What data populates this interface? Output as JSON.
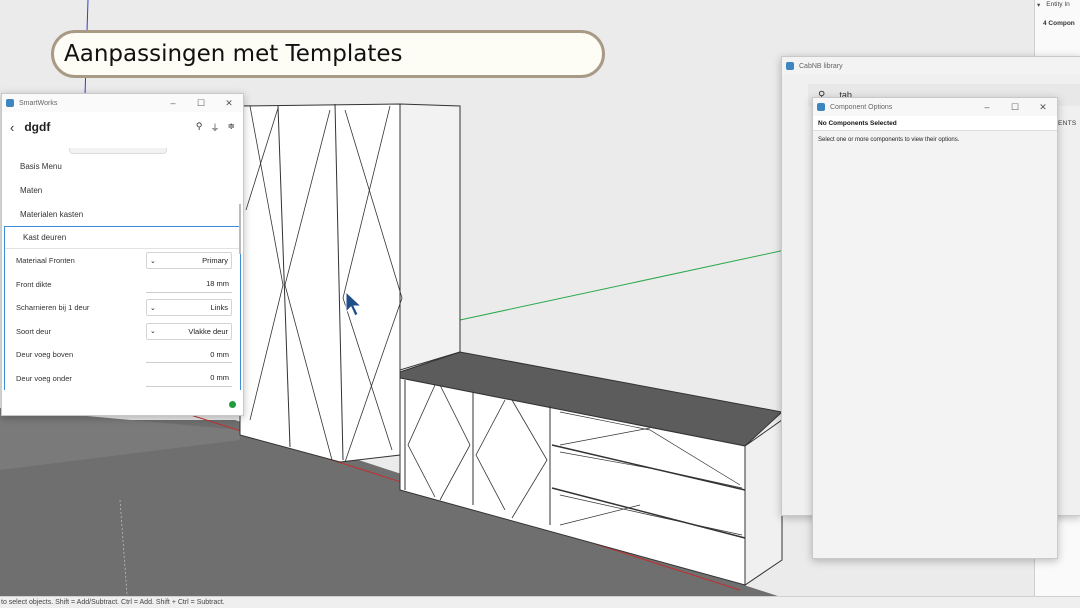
{
  "banner": {
    "title": "Aanpassingen met Templates"
  },
  "smartworks": {
    "window_title": "SmartWorks",
    "header_title": "dgdf",
    "menu_items": [
      "Basis Menu",
      "Maten",
      "Materialen kasten"
    ],
    "section_title": "Kast deuren",
    "rows": [
      {
        "label": "Materiaal Fronten",
        "value": "Primary",
        "type": "select"
      },
      {
        "label": "Front dikte",
        "value": "18 mm",
        "type": "input"
      },
      {
        "label": "Scharnieren bij 1 deur",
        "value": "Links",
        "type": "select"
      },
      {
        "label": "Soort deur",
        "value": "Vlakke deur",
        "type": "select"
      },
      {
        "label": "Deur voeg boven",
        "value": "0 mm",
        "type": "input"
      },
      {
        "label": "Deur voeg onder",
        "value": "0 mm",
        "type": "input"
      }
    ]
  },
  "cabnb": {
    "window_title": "CabNB library",
    "search_value": "tab",
    "edge_text": "ENTS"
  },
  "component_options": {
    "window_title": "Component Options",
    "heading": "No Components Selected",
    "hint": "Select one or more components to view their options."
  },
  "entity_info": {
    "title": "Entity In",
    "count_text": "4 Compon"
  },
  "statusbar": {
    "text": "to select objects. Shift = Add/Subtract. Ctrl = Add. Shift + Ctrl = Subtract."
  },
  "colors": {
    "accent": "#3b8ed8",
    "status_ok": "#1f9c3c",
    "banner_border": "#a89a84"
  }
}
